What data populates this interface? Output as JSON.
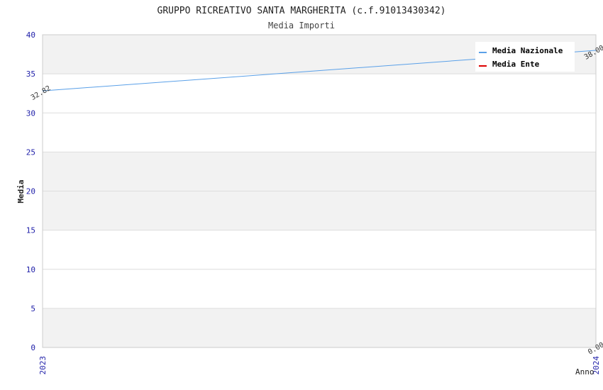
{
  "chart_data": {
    "type": "line",
    "title": "GRUPPO RICREATIVO SANTA MARGHERITA (c.f.91013430342)",
    "subtitle": "Media Importi",
    "xlabel": "Anno",
    "ylabel": "Media",
    "x": [
      "2023",
      "2024"
    ],
    "ylim": [
      0,
      40
    ],
    "yticks": [
      "0",
      "5",
      "10",
      "15",
      "20",
      "25",
      "30",
      "35",
      "40"
    ],
    "grid": true,
    "legend_position": "top-right",
    "series": [
      {
        "name": "Media Nazionale",
        "color": "#5aa0e8",
        "values": [
          32.82,
          38.0
        ],
        "labels": [
          "32.82",
          "38.00"
        ]
      },
      {
        "name": "Media Ente",
        "color": "#dd0000",
        "values": [
          null,
          0.0
        ],
        "labels": [
          "",
          "0.00"
        ]
      }
    ]
  }
}
